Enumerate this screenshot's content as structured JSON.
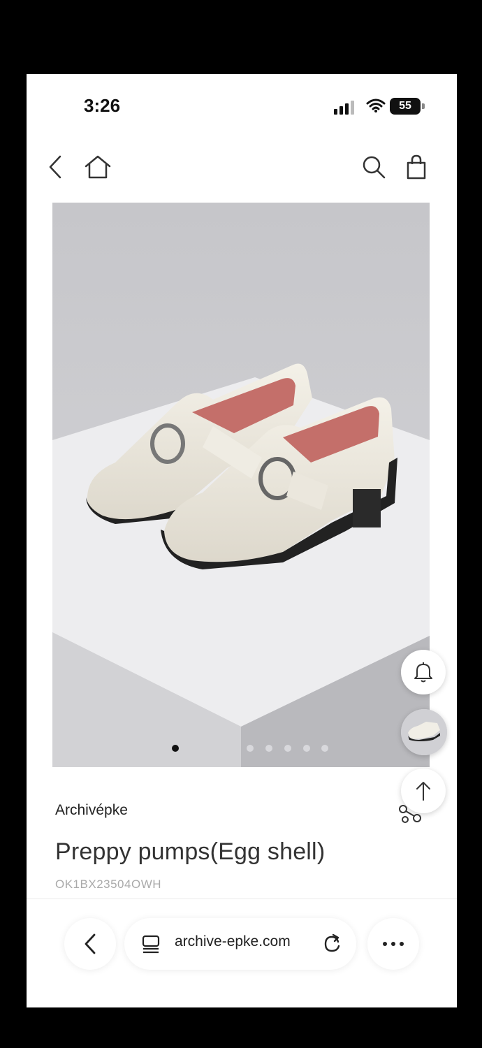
{
  "status_bar": {
    "time": "3:26",
    "battery": "55"
  },
  "nav": {
    "icons": [
      "chevron-left-icon",
      "home-icon",
      "search-icon",
      "shopping-bag-icon"
    ]
  },
  "gallery": {
    "image_count": 6,
    "active_index": 0
  },
  "product": {
    "brand": "Archivépke",
    "title": "Preppy pumps(Egg shell)",
    "sku": "OK1BX23504OWH"
  },
  "browser": {
    "url": "archive-epke.com"
  },
  "colors": {
    "background": "#000000",
    "page": "#ffffff",
    "accent": "#111111"
  }
}
